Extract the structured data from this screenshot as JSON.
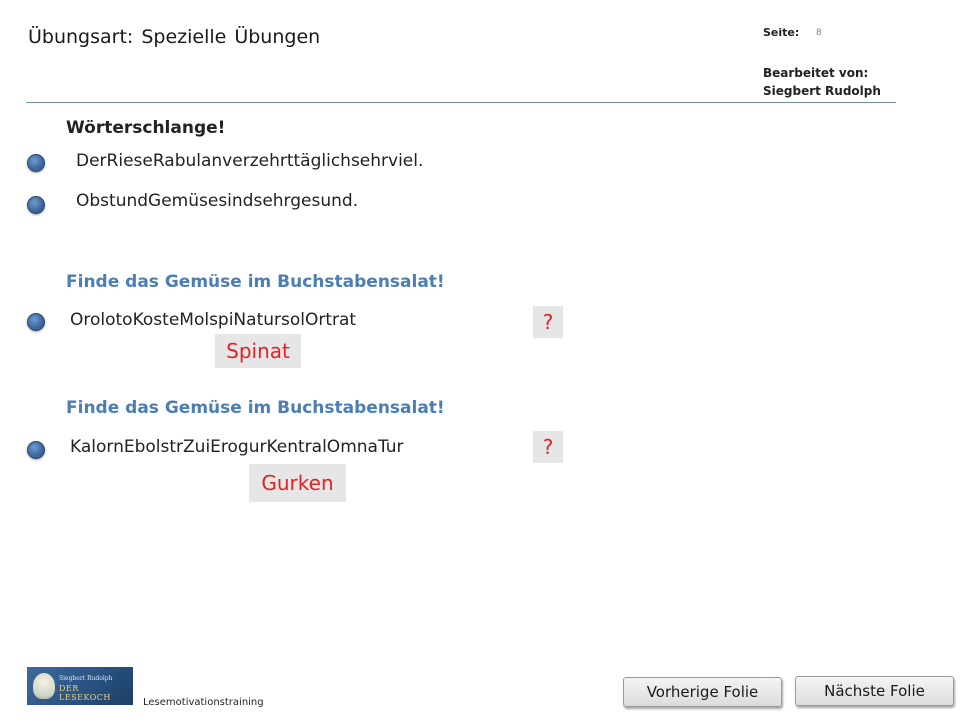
{
  "header": {
    "title_parts": [
      "Übungsart:",
      "Spezielle",
      "Übungen"
    ],
    "page_label": "Seite:",
    "page_number": "8",
    "edited_by_label": "Bearbeitet von:",
    "edited_by_name": "Siegbert Rudolph"
  },
  "section1": {
    "heading": "Wörterschlange!",
    "items": [
      "DerRieseRabulanverzehrttäglichsehrviel.",
      "ObstundGemüsesindsehrgesund."
    ]
  },
  "section2": {
    "heading": "Finde das Gemüse im Buchstabensalat!",
    "puzzle": "OrolotoKosteMolspiNatursolOrtrat",
    "question_mark": "?",
    "answer": "Spinat"
  },
  "section3": {
    "heading": "Finde das Gemüse im Buchstabensalat!",
    "puzzle": "KalornEbolstrZuiErogurKentralOmnaTur",
    "question_mark": "?",
    "answer": "Gurken"
  },
  "footer": {
    "logo_name": "Siegbert Rudolph",
    "logo_brand": "DER LESEKOCH",
    "label": "Lesemotivationstraining",
    "prev_button": "Vorherige Folie",
    "next_button": "Nächste Folie"
  }
}
